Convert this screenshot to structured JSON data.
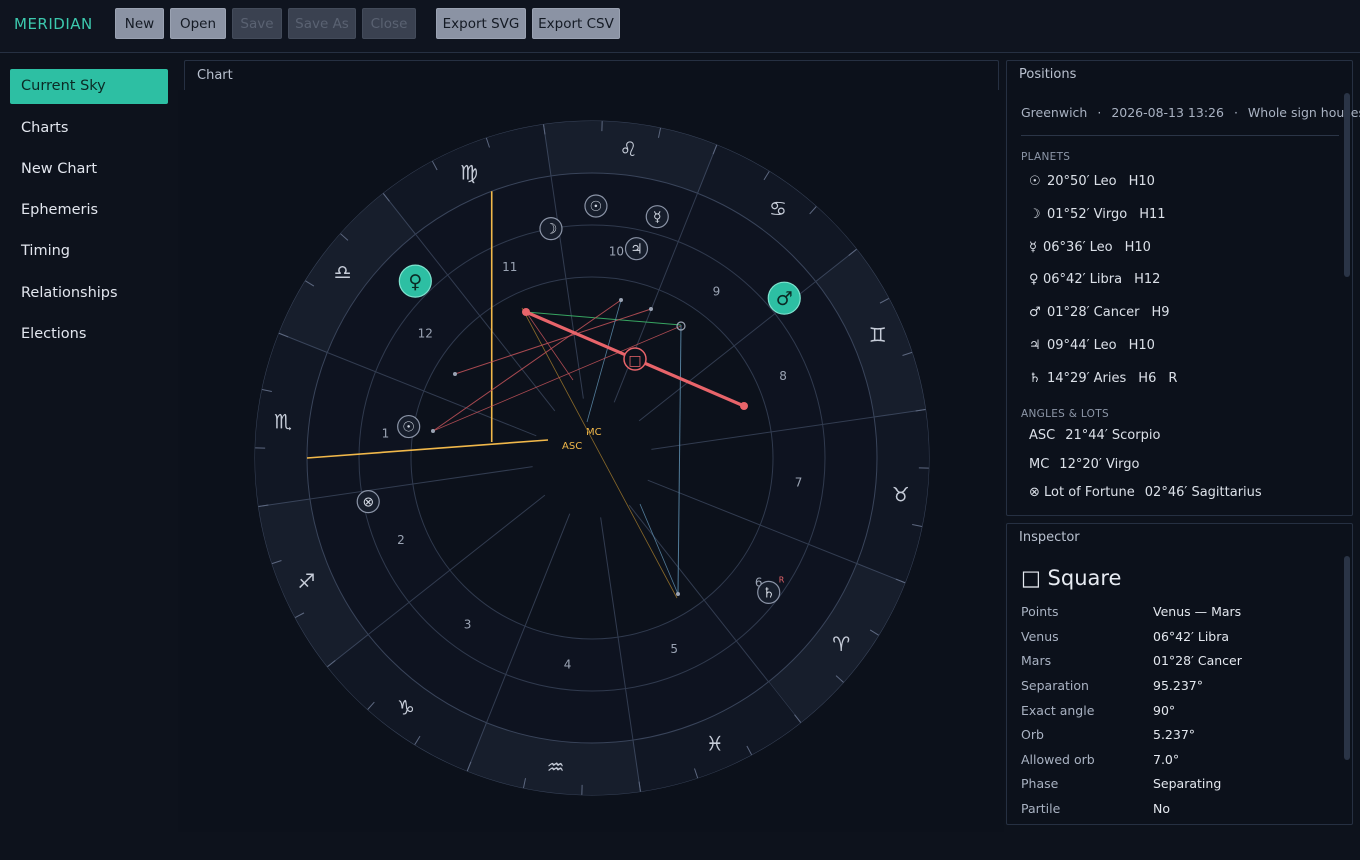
{
  "app": {
    "brand": "MERIDIAN"
  },
  "toolbar": {
    "new_label": "New",
    "open_label": "Open",
    "save_label": "Save",
    "save_as_label": "Save As",
    "close_label": "Close",
    "export_svg_label": "Export SVG",
    "export_csv_label": "Export CSV"
  },
  "sidebar": {
    "items": [
      {
        "label": "Current Sky",
        "active": true
      },
      {
        "label": "Charts"
      },
      {
        "label": "New Chart"
      },
      {
        "label": "Ephemeris"
      },
      {
        "label": "Timing"
      },
      {
        "label": "Relationships"
      },
      {
        "label": "Elections"
      }
    ]
  },
  "chart_panel": {
    "title": "Chart",
    "signs": [
      "Aries",
      "Taurus",
      "Gemini",
      "Cancer",
      "Leo",
      "Virgo",
      "Libra",
      "Scorpio",
      "Sagittarius",
      "Capricorn",
      "Aquarius",
      "Pisces"
    ],
    "sign_glyphs": [
      "♈",
      "♉",
      "♊",
      "♋",
      "♌",
      "♍",
      "♎",
      "♏",
      "♐",
      "♑",
      "♒",
      "♓"
    ],
    "house_numbers": [
      "1",
      "2",
      "3",
      "4",
      "5",
      "6",
      "7",
      "8",
      "9",
      "10",
      "11",
      "12"
    ],
    "asc_label": "ASC",
    "mc_label": "MC",
    "ascendant_longitude": 231.73,
    "mc_longitude": 162.33,
    "bodies": [
      {
        "name": "Sun",
        "glyph": "☉",
        "longitude": 140.83
      },
      {
        "name": "Moon",
        "glyph": "☽",
        "longitude": 151.87
      },
      {
        "name": "Mercury",
        "glyph": "☿",
        "longitude": 126.6
      },
      {
        "name": "Venus",
        "glyph": "♀",
        "longitude": 186.7,
        "highlight": true
      },
      {
        "name": "Mars",
        "glyph": "♂",
        "longitude": 91.47,
        "highlight": true
      },
      {
        "name": "Jupiter",
        "glyph": "♃",
        "longitude": 129.73
      },
      {
        "name": "Saturn",
        "glyph": "♄",
        "longitude": 14.48,
        "retro": "R"
      },
      {
        "name": "Lot of Fortune",
        "glyph": "⊗",
        "longitude": 242.77
      },
      {
        "name": "Point",
        "glyph": "☉",
        "longitude": 222
      }
    ],
    "selected_aspect_glyph": "□",
    "colors": {
      "accent": "#2dbfa3",
      "axis": "#f1b84a",
      "square": "#e8646a",
      "trine": "#3fbf6e",
      "hard": "#c4535a",
      "soft": "#5f8fb0"
    }
  },
  "positions": {
    "title": "Positions",
    "location": "Greenwich",
    "datetime": "2026-08-13 13:26",
    "house_system": "Whole sign houses",
    "dot": "·",
    "planets_header": "PLANETS",
    "planets": [
      {
        "glyph": "☉",
        "pos": "20°50′ Leo",
        "house": "H10",
        "retro": ""
      },
      {
        "glyph": "☽",
        "pos": "01°52′ Virgo",
        "house": "H11",
        "retro": ""
      },
      {
        "glyph": "☿",
        "pos": "06°36′ Leo",
        "house": "H10",
        "retro": ""
      },
      {
        "glyph": "♀",
        "pos": "06°42′ Libra",
        "house": "H12",
        "retro": ""
      },
      {
        "glyph": "♂",
        "pos": "01°28′ Cancer",
        "house": "H9",
        "retro": ""
      },
      {
        "glyph": "♃",
        "pos": "09°44′ Leo",
        "house": "H10",
        "retro": ""
      },
      {
        "glyph": "♄",
        "pos": "14°29′ Aries",
        "house": "H6",
        "retro": "R"
      }
    ],
    "angles_header": "ANGLES & LOTS",
    "angles": [
      {
        "label": "ASC",
        "pos": "21°44′ Scorpio"
      },
      {
        "label": "MC",
        "pos": "12°20′ Virgo"
      },
      {
        "label": "⊗ Lot of Fortune",
        "pos": "02°46′ Sagittarius"
      }
    ]
  },
  "inspector": {
    "title": "Inspector",
    "aspect_glyph": "□",
    "aspect_name": "Square",
    "rows": [
      {
        "label": "Points",
        "value": "Venus — Mars"
      },
      {
        "label": "Venus",
        "value": "06°42′ Libra"
      },
      {
        "label": "Mars",
        "value": "01°28′ Cancer"
      },
      {
        "label": "Separation",
        "value": "95.237°"
      },
      {
        "label": "Exact angle",
        "value": "90°"
      },
      {
        "label": "Orb",
        "value": "5.237°"
      },
      {
        "label": "Allowed orb",
        "value": "7.0°"
      },
      {
        "label": "Phase",
        "value": "Separating"
      },
      {
        "label": "Partile",
        "value": "No"
      }
    ]
  }
}
